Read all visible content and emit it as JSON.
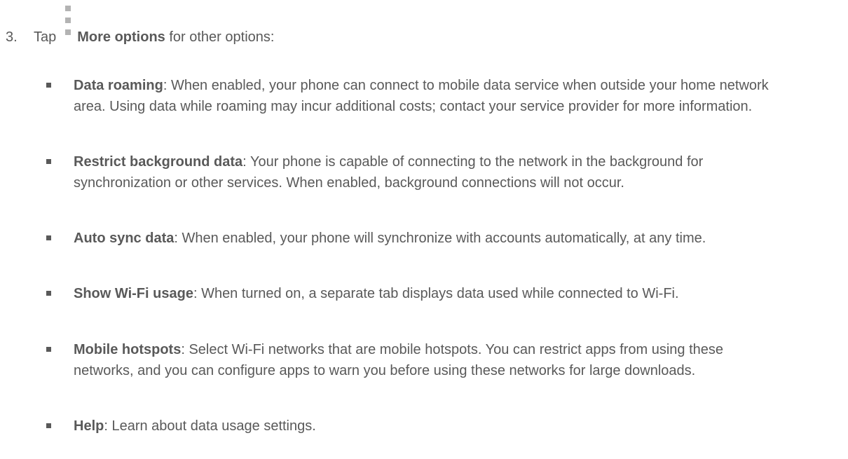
{
  "step": {
    "number": "3.",
    "prefix": "Tap",
    "icon_name": "more-options-icon",
    "label": "More options",
    "suffix": "for other options:"
  },
  "options": [
    {
      "title": "Data roaming",
      "separator": ":",
      "text": "When enabled, your phone can connect to mobile data service when outside your home network area. Using data while roaming may incur additional costs; contact your service provider for more information."
    },
    {
      "title": "Restrict background data",
      "separator": ":",
      "text": "Your phone is capable of connecting to the network in the background for synchronization or other services. When enabled, background connections will not occur."
    },
    {
      "title": "Auto sync data",
      "separator": ":",
      "text": "When enabled, your phone will synchronize with accounts automatically, at any time."
    },
    {
      "title": "Show Wi-Fi usage",
      "separator": ":",
      "text": "When turned on, a separate tab displays data used while connected to Wi-Fi."
    },
    {
      "title": "Mobile hotspots",
      "separator": ":",
      "text": "Select Wi-Fi networks that are mobile hotspots. You can restrict apps from using these networks, and you can configure apps to warn you before using these networks for large downloads."
    },
    {
      "title": "Help",
      "separator": ":",
      "text": "Learn about data usage settings."
    }
  ],
  "colors": {
    "text": "#595959",
    "icon": "#b3b3b3",
    "background": "#ffffff"
  }
}
